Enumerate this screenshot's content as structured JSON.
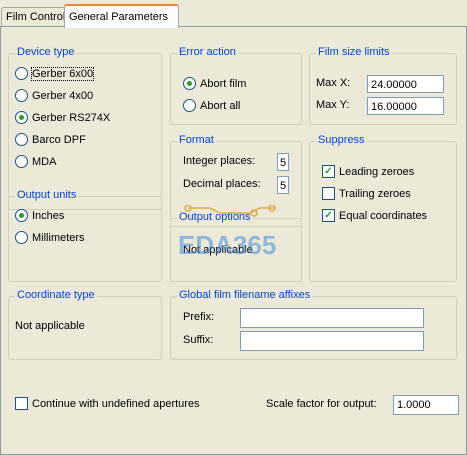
{
  "tabs": [
    {
      "label": "Film Control"
    },
    {
      "label": "General Parameters"
    }
  ],
  "device_type": {
    "title": "Device type",
    "options": [
      {
        "label": "Gerber 6x00",
        "selected": false
      },
      {
        "label": "Gerber 4x00",
        "selected": false
      },
      {
        "label": "Gerber RS274X",
        "selected": true
      },
      {
        "label": "Barco DPF",
        "selected": false
      },
      {
        "label": "MDA",
        "selected": false
      }
    ]
  },
  "output_units": {
    "title": "Output units",
    "options": [
      {
        "label": "Inches",
        "selected": true
      },
      {
        "label": "Millimeters",
        "selected": false
      }
    ]
  },
  "coordinate_type": {
    "title": "Coordinate type",
    "value": "Not applicable"
  },
  "error_action": {
    "title": "Error action",
    "options": [
      {
        "label": "Abort film",
        "selected": true
      },
      {
        "label": "Abort all",
        "selected": false
      }
    ]
  },
  "format": {
    "title": "Format",
    "integer_label": "Integer places:",
    "integer_value": "5",
    "decimal_label": "Decimal places:",
    "decimal_value": "5"
  },
  "output_options": {
    "title": "Output options",
    "value": "Not applicable"
  },
  "film_size_limits": {
    "title": "Film size limits",
    "max_x_label": "Max X:",
    "max_x_value": "24.00000",
    "max_y_label": "Max Y:",
    "max_y_value": "16.00000"
  },
  "suppress": {
    "title": "Suppress",
    "options": [
      {
        "label": "Leading zeroes",
        "checked": true
      },
      {
        "label": "Trailing zeroes",
        "checked": false
      },
      {
        "label": "Equal coordinates",
        "checked": true
      }
    ]
  },
  "affixes": {
    "title": "Global film filename affixes",
    "prefix_label": "Prefix:",
    "prefix_value": "",
    "suffix_label": "Suffix:",
    "suffix_value": ""
  },
  "bottom": {
    "continue_label": "Continue with undefined apertures",
    "continue_checked": false,
    "scale_label": "Scale factor for output:",
    "scale_value": "1.0000"
  },
  "watermark": {
    "text": "EDA365"
  }
}
